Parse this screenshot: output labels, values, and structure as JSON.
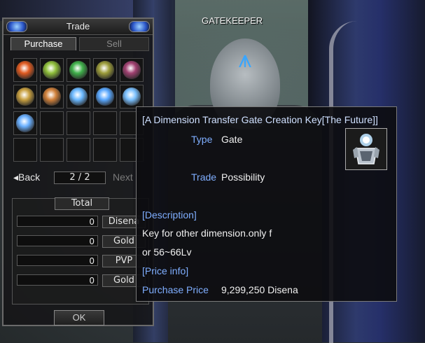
{
  "npc": {
    "name": "GATEKEEPER"
  },
  "trade_window": {
    "title": "Trade",
    "tabs": [
      {
        "label": "Purchase",
        "active": true
      },
      {
        "label": "Sell",
        "active": false
      }
    ],
    "slots": [
      {
        "icon": "fire-gem-ring-icon",
        "color": "#e05a20"
      },
      {
        "icon": "green-gem-ring-icon",
        "color": "#8fbf3a"
      },
      {
        "icon": "emerald-ring-icon",
        "color": "#3fb04a"
      },
      {
        "icon": "olive-ring-icon",
        "color": "#9c9c3a"
      },
      {
        "icon": "purple-box-icon",
        "color": "#a04070"
      },
      {
        "icon": "gold-ring-icon",
        "color": "#c8a040"
      },
      {
        "icon": "star-amulet-icon",
        "color": "#d0803a"
      },
      {
        "icon": "blue-gate-key-icon",
        "color": "#6ab8ff"
      },
      {
        "icon": "blue-gate-key-icon",
        "color": "#5aa8ff"
      },
      {
        "icon": "blue-gate-key-icon",
        "color": "#7ac0ff"
      },
      {
        "icon": "blue-gate-key-icon",
        "color": "#6ab0ff"
      }
    ],
    "pager": {
      "back_label": "Back",
      "page": "2 / 2",
      "next_label": "Next"
    },
    "total_label": "Total",
    "totals": [
      {
        "amount": "0",
        "currency": "Disena"
      },
      {
        "amount": "0",
        "currency": "Gold"
      },
      {
        "amount": "0",
        "currency": "PVP"
      },
      {
        "amount": "0",
        "currency": "Gold"
      }
    ],
    "ok_label": "OK"
  },
  "tooltip": {
    "title": "[A Dimension Transfer Gate Creation Key[The Future]]",
    "type_label": "Type",
    "type_value": "Gate",
    "trade_label": "Trade",
    "trade_value": "Possibility",
    "description_label": "[Description]",
    "description_line1": "Key for other dimension.only f",
    "description_line2": "or 56~66Lv",
    "price_info_label": "[Price info]",
    "purchase_price_label": "Purchase Price",
    "purchase_price_value": "9,299,250 Disena",
    "icon": "blue-gate-key-icon"
  }
}
